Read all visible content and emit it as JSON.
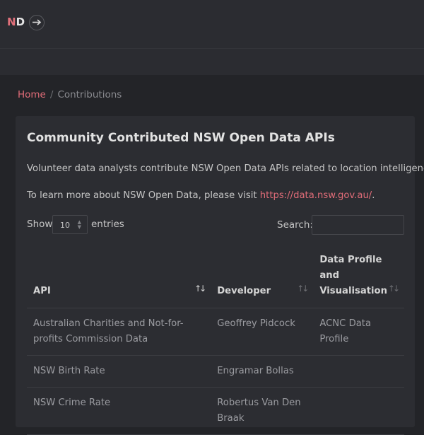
{
  "header": {
    "logo_n": "N",
    "logo_d": "D",
    "arrow_icon": "arrow-right-icon"
  },
  "breadcrumb": {
    "home": "Home",
    "separator": "/",
    "current": "Contributions"
  },
  "card": {
    "title": "Community Contributed NSW Open Data APIs",
    "intro": "Volunteer data analysts contribute NSW Open Data APIs related to location intelligence.",
    "learn_more_prefix": "To learn more about NSW Open Data, please visit ",
    "learn_more_link": "https://data.nsw.gov.au/",
    "learn_more_suffix": "."
  },
  "controls": {
    "show_label": "Show",
    "page_size": "10",
    "entries_label": "entries",
    "search_label": "Search:",
    "search_value": ""
  },
  "table": {
    "headers": [
      "API",
      "Developer",
      "Data Profile and Visualisation"
    ],
    "rows": [
      [
        "Australian Charities and Not-for-profits Commission Data",
        "Geoffrey Pidcock",
        "ACNC Data Profile"
      ],
      [
        "NSW Birth Rate",
        "Engramar Bollas",
        ""
      ],
      [
        "NSW Crime Rate",
        "Robertus Van Den Braak",
        ""
      ]
    ]
  },
  "colors": {
    "accent": "#e06c78",
    "background": "#232428",
    "card": "#2c2d32"
  }
}
